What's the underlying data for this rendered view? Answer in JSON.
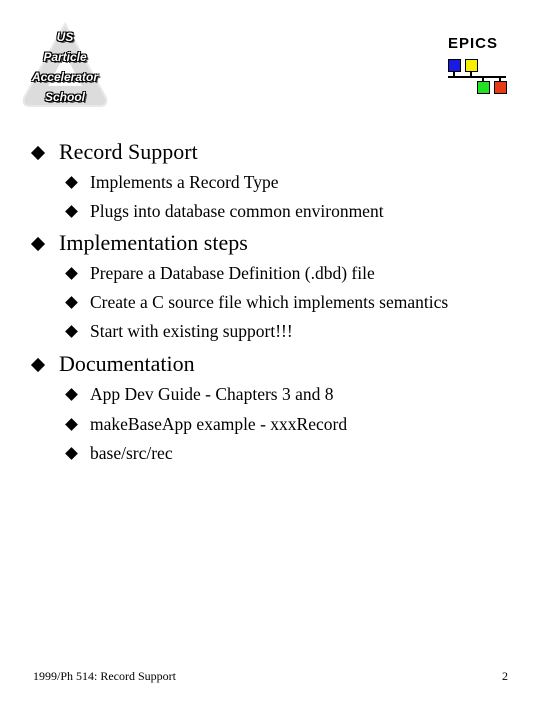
{
  "logos": {
    "left": {
      "icon": "uspas-logo-icon",
      "lines": [
        "US",
        "Particle",
        "Accelerator",
        "School"
      ]
    },
    "right": {
      "icon": "epics-logo-icon",
      "title": "EPICS",
      "colors": [
        "#1a1ae0",
        "#f5f000",
        "#22e022",
        "#e83a16"
      ]
    }
  },
  "bullets": [
    {
      "text": "Record Support",
      "children": [
        "Implements a Record Type",
        "Plugs into database common environment"
      ]
    },
    {
      "text": "Implementation steps",
      "children": [
        "Prepare a Database Definition (.dbd) file",
        "Create a C source file which implements semantics",
        "Start with existing support!!!"
      ]
    },
    {
      "text": "Documentation",
      "children": [
        "App Dev Guide - Chapters 3 and 8",
        "makeBaseApp example - xxxRecord",
        "base/src/rec"
      ]
    }
  ],
  "footer": {
    "left": "1999/Ph 514: Record Support",
    "page_number": "2"
  }
}
